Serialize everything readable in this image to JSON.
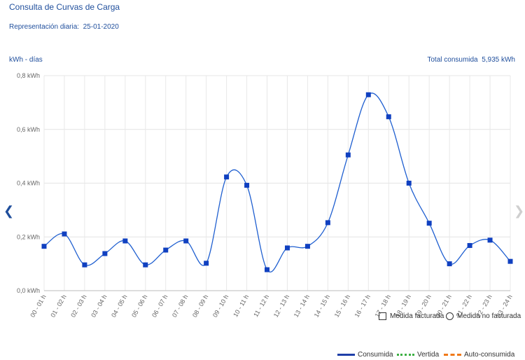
{
  "header": {
    "title": "Consulta de Curvas de Carga",
    "subtitle_label": "Representación diaria:",
    "subtitle_date": "25-01-2020",
    "unit_label": "kWh - días",
    "total_label": "Total consumida",
    "total_value": "5,935 kWh"
  },
  "legend_markers": [
    {
      "label": "Medida facturada",
      "icon": "square-icon"
    },
    {
      "label": "Medida no facturada",
      "icon": "circle-icon"
    }
  ],
  "legend_lines": [
    {
      "label": "Consumida",
      "color": "#1f3fa8",
      "style": "solid"
    },
    {
      "label": "Vertida",
      "color": "#3cb043",
      "style": "dotted"
    },
    {
      "label": "Auto-consumida",
      "color": "#f07a1a",
      "style": "dashed"
    }
  ],
  "nav": {
    "prev_icon": "chevron-left-icon",
    "next_icon": "chevron-right-icon"
  },
  "chart_data": {
    "type": "line",
    "categories": [
      "00 - 01 h",
      "01 - 02 h",
      "02 - 03 h",
      "03 - 04 h",
      "04 - 05 h",
      "05 - 06 h",
      "06 - 07 h",
      "07 - 08 h",
      "08 - 09 h",
      "09 - 10 h",
      "10 - 11 h",
      "11 - 12 h",
      "12 - 13 h",
      "13 - 14 h",
      "14 - 15 h",
      "15 - 16 h",
      "16 - 17 h",
      "17 - 18 h",
      "18 - 19 h",
      "19 - 20 h",
      "20 - 21 h",
      "21 - 22 h",
      "22 - 23 h",
      "23 - 24 h"
    ],
    "series": [
      {
        "name": "Consumida",
        "color": "#1f5fd0",
        "marker_color": "#1040c0",
        "values": [
          0.165,
          0.211,
          0.096,
          0.138,
          0.185,
          0.096,
          0.151,
          0.185,
          0.102,
          0.423,
          0.392,
          0.078,
          0.159,
          0.165,
          0.253,
          0.505,
          0.729,
          0.647,
          0.4,
          0.251,
          0.1,
          0.168,
          0.188,
          0.109
        ]
      }
    ],
    "yticks": [
      "0,0 kWh",
      "0,2 kWh",
      "0,4 kWh",
      "0,6 kWh",
      "0,8 kWh"
    ],
    "ytick_values": [
      0,
      0.2,
      0.4,
      0.6,
      0.8
    ],
    "ylim": [
      0,
      0.8
    ],
    "grid": true
  }
}
